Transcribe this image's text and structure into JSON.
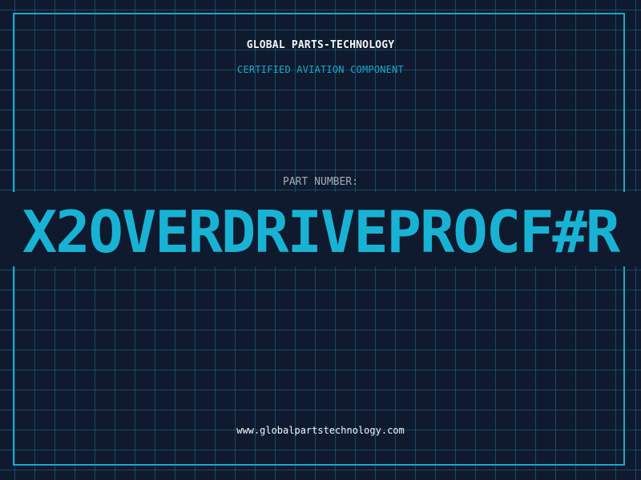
{
  "header": {
    "company": "GLOBAL PARTS-TECHNOLOGY",
    "tagline": "CERTIFIED AVIATION COMPONENT"
  },
  "part": {
    "label": "PART NUMBER:",
    "number": "X2OVERDRIVEPROCF#R"
  },
  "footer": {
    "website": "www.globalpartstechnology.com"
  },
  "colors": {
    "background": "#0f1a2e",
    "accent": "#18b3d4",
    "grid": "#1e6e8c",
    "text": "#f2f5f7",
    "muted": "#a4adb8"
  }
}
